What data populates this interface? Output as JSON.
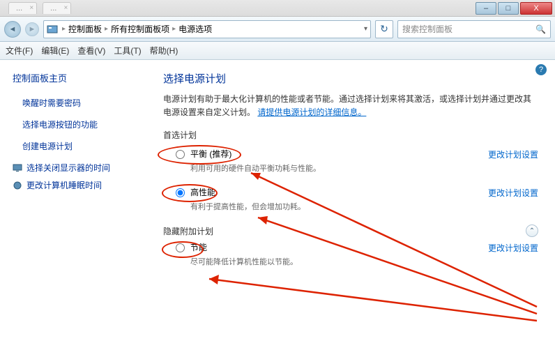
{
  "titlebar": {
    "tab1": "...",
    "tab2": "..."
  },
  "window": {
    "min": "–",
    "max": "□",
    "close": "X"
  },
  "breadcrumb": {
    "root": "控制面板",
    "mid": "所有控制面板项",
    "leaf": "电源选项"
  },
  "search": {
    "placeholder": "搜索控制面板"
  },
  "menu": {
    "file": "文件(F)",
    "edit": "编辑(E)",
    "view": "查看(V)",
    "tools": "工具(T)",
    "help": "帮助(H)"
  },
  "sidebar": {
    "home": "控制面板主页",
    "items": [
      {
        "label": "唤醒时需要密码"
      },
      {
        "label": "选择电源按钮的功能"
      },
      {
        "label": "创建电源计划"
      }
    ],
    "display": "选择关闭显示器的时间",
    "sleep": "更改计算机睡眠时间"
  },
  "content": {
    "heading": "选择电源计划",
    "desc_a": "电源计划有助于最大化计算机的性能或者节能。通过选择计划来将其激活，或选择计划并通过更改其电源设置来自定义计划。",
    "desc_link": "请提供电源计划的详细信息。",
    "preferred": "首选计划",
    "plan1": {
      "name": "平衡 (推荐)",
      "sub": "利用可用的硬件自动平衡功耗与性能。"
    },
    "plan2": {
      "name": "高性能",
      "sub": "有利于提高性能，但会增加功耗。"
    },
    "hidden": "隐藏附加计划",
    "plan3": {
      "name": "节能",
      "sub": "尽可能降低计算机性能以节能。"
    },
    "change": "更改计划设置"
  }
}
